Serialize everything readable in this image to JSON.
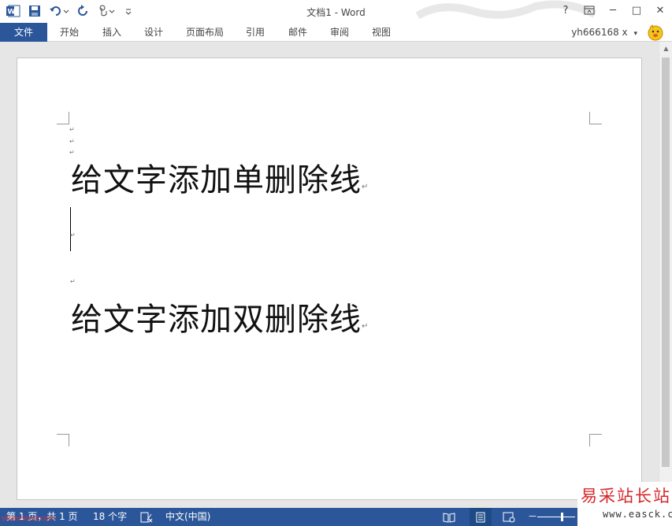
{
  "window": {
    "title": "文档1 - Word",
    "controls": {
      "help": "?",
      "minimize": "─",
      "restore": "□",
      "close": "✕"
    }
  },
  "ribbon": {
    "tabs": [
      "文件",
      "开始",
      "插入",
      "设计",
      "页面布局",
      "引用",
      "邮件",
      "审阅",
      "视图"
    ],
    "user": "yh666168 x",
    "user_dropdown": "▾"
  },
  "document": {
    "lines": [
      "给文字添加单删除线",
      "给文字添加双删除线"
    ],
    "paragraph_mark": "↵"
  },
  "statusbar": {
    "page": "第 1 页，共 1 页",
    "words": "18 个字",
    "language": "中文(中国)",
    "zoom_minus": "－"
  },
  "watermark": {
    "left_text": "shancloud.com",
    "right_title": "易采站长站",
    "right_url": "www.easck.com"
  },
  "colors": {
    "accent": "#2b579a",
    "watermark_red": "#d6282b"
  }
}
